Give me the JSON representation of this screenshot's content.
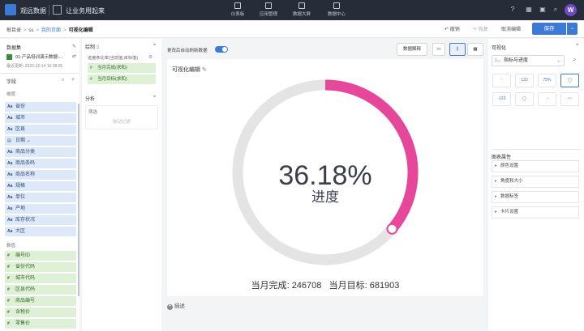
{
  "app": {
    "brand": "观远数据",
    "slogan": "让业务用起来"
  },
  "nav": [
    {
      "label": "仪表板",
      "icon": "dashboard-icon"
    },
    {
      "label": "应用管理",
      "icon": "app-manage-icon"
    },
    {
      "label": "数据大屏",
      "icon": "data-screen-icon"
    },
    {
      "label": "数据中心",
      "icon": "data-center-icon"
    }
  ],
  "user": {
    "avatar_letter": "W"
  },
  "breadcrumb": {
    "root": "根目录",
    "level1": "ss",
    "level2": "我的页面",
    "current": "可视化编辑"
  },
  "toolbar": {
    "undo": "撤销",
    "redo": "恢复",
    "cancel": "取消编辑",
    "save": "保存"
  },
  "dataset": {
    "title": "数据集",
    "name": "01-产品培训演示数据-...",
    "updated": "最近更新: 2022-12-14 10:28:05"
  },
  "fields": {
    "title": "字段",
    "dim_title": "维度",
    "dimensions": [
      "省份",
      "城市",
      "区县",
      "日期",
      "商品分类",
      "商品条码",
      "商品名称",
      "规格",
      "单位",
      "产地",
      "库存状况",
      "大区"
    ],
    "measure_title": "数值",
    "measures": [
      "编号ID",
      "省份代码",
      "城市代码",
      "区县代码",
      "商品编号",
      "含税价",
      "零售价"
    ]
  },
  "config": {
    "drawing_title": "绘制",
    "drawing_count": "3",
    "progress_label": "进度条比率(当前值,目标值)",
    "chip1": "当月完成(求和)",
    "chip2": "当月目标(求和)",
    "analysis_title": "分析",
    "filter_label": "筛选",
    "filter_placeholder": "拖动过滤"
  },
  "canvas": {
    "auto_refresh": "更改后自动刷新数据",
    "explain_btn": "数据解释",
    "chart_title": "可视化编辑",
    "describe": "描述"
  },
  "chart_data": {
    "type": "progress-ring",
    "value_text": "36.18%",
    "label": "进度",
    "current_label": "当月完成",
    "current": 246708,
    "target_label": "当月目标",
    "target": 681903,
    "fraction": 0.3618,
    "colors": {
      "progress": "#e6479b",
      "track": "#e4e4e4"
    }
  },
  "right_panel": {
    "vis_title": "可视化",
    "type_select": "指标与进度",
    "vis_options": [
      "",
      "123",
      "75%",
      "",
      "-123",
      "",
      "",
      ""
    ],
    "props_title": "图表属性",
    "props": [
      "颜色设置",
      "角度和大小",
      "数据标签",
      "卡片设置"
    ]
  }
}
